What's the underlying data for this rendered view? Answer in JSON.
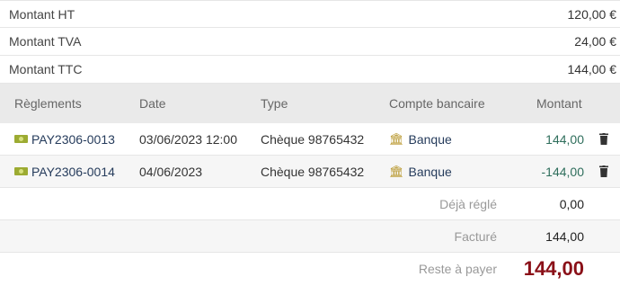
{
  "totals": [
    {
      "label": "Montant HT",
      "value": "120,00 €"
    },
    {
      "label": "Montant TVA",
      "value": "24,00 €"
    },
    {
      "label": "Montant TTC",
      "value": "144,00 €"
    }
  ],
  "payments": {
    "headers": [
      "Règlements",
      "Date",
      "Type",
      "Compte bancaire",
      "Montant"
    ],
    "rows": [
      {
        "ref": "PAY2306-0013",
        "date": "03/06/2023 12:00",
        "type": "Chèque 98765432",
        "account": "Banque",
        "amount": "144,00"
      },
      {
        "ref": "PAY2306-0014",
        "date": "04/06/2023",
        "type": "Chèque 98765432",
        "account": "Banque",
        "amount": "-144,00"
      }
    ]
  },
  "summary": {
    "already_paid_label": "Déjà réglé",
    "already_paid_value": "0,00",
    "invoiced_label": "Facturé",
    "invoiced_value": "144,00",
    "remaining_label": "Reste à payer",
    "remaining_value": "144,00"
  },
  "colors": {
    "link": "#263c5c",
    "amount": "#2f6e5c",
    "remaining": "#8a1018",
    "header_bg": "#eaeaea"
  },
  "icons": [
    "money-bill-icon",
    "bank-icon",
    "trash-icon"
  ]
}
